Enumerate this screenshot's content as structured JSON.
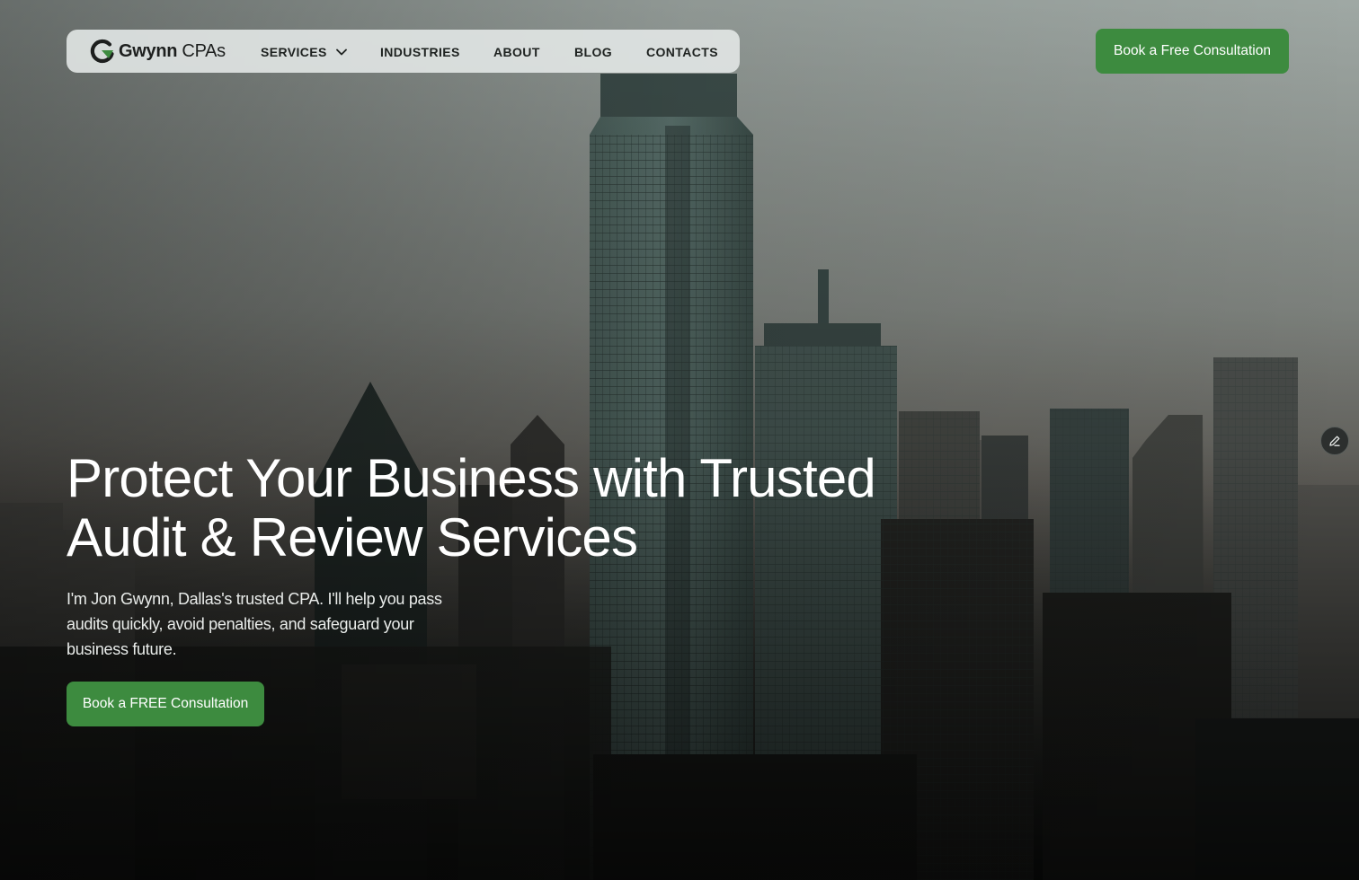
{
  "brand": {
    "name_bold": "Gwynn",
    "name_rest": " CPAs",
    "logo_icon": "g-logo-icon"
  },
  "nav": {
    "items": [
      {
        "label": "SERVICES",
        "has_dropdown": true
      },
      {
        "label": "INDUSTRIES"
      },
      {
        "label": "ABOUT"
      },
      {
        "label": "BLOG"
      },
      {
        "label": "CONTACTS"
      }
    ]
  },
  "header_cta": {
    "label": "Book a Free Consultation"
  },
  "hero": {
    "headline_line1": "Protect Your Business with Trusted",
    "headline_line2": "Audit & Review Services",
    "sub_line1": "I'm Jon Gwynn, Dallas's trusted CPA. I'll help you pass",
    "sub_line2": "audits quickly, avoid penalties, and safeguard your",
    "sub_line3": "business future.",
    "cta_label": "Book a FREE Consultation"
  },
  "floating": {
    "edit_icon": "pencil-icon"
  },
  "colors": {
    "accent_green": "#3d8b3f",
    "nav_bg": "#e2e7e5",
    "sky_top": "#9aa39f",
    "ground_dark": "#141816"
  }
}
